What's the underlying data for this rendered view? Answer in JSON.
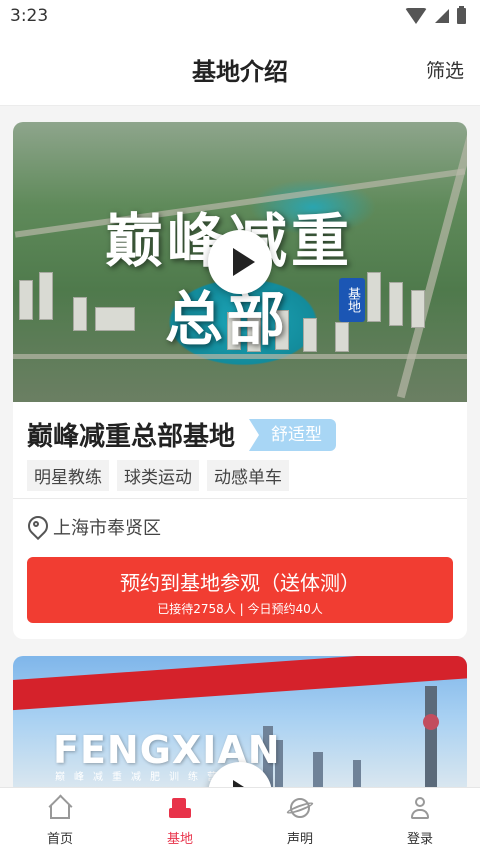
{
  "status": {
    "time": "3:23"
  },
  "header": {
    "title": "基地介绍",
    "filter_label": "筛选"
  },
  "cards": [
    {
      "hero_calligraphy": [
        "巅峰减重",
        "总部"
      ],
      "hero_tag": "基地",
      "name": "巅峰减重总部基地",
      "type_badge": "舒适型",
      "tags": [
        "明星教练",
        "球类运动",
        "动感单车"
      ],
      "location": "上海市奉贤区",
      "book_label": "预约到基地参观（送体测）",
      "book_sub": "已接待2758人 | 今日预约40人"
    },
    {
      "hero_title": "FENGXIAN",
      "hero_sub": "巅峰减重减肥训练营"
    }
  ],
  "nav": {
    "items": [
      {
        "label": "首页",
        "icon": "home-icon"
      },
      {
        "label": "基地",
        "icon": "building-icon",
        "active": true
      },
      {
        "label": "声明",
        "icon": "planet-icon"
      },
      {
        "label": "登录",
        "icon": "user-icon"
      }
    ]
  },
  "colors": {
    "accent": "#f13d32",
    "nav_active": "#e8334a",
    "badge": "#a8d6f5"
  }
}
